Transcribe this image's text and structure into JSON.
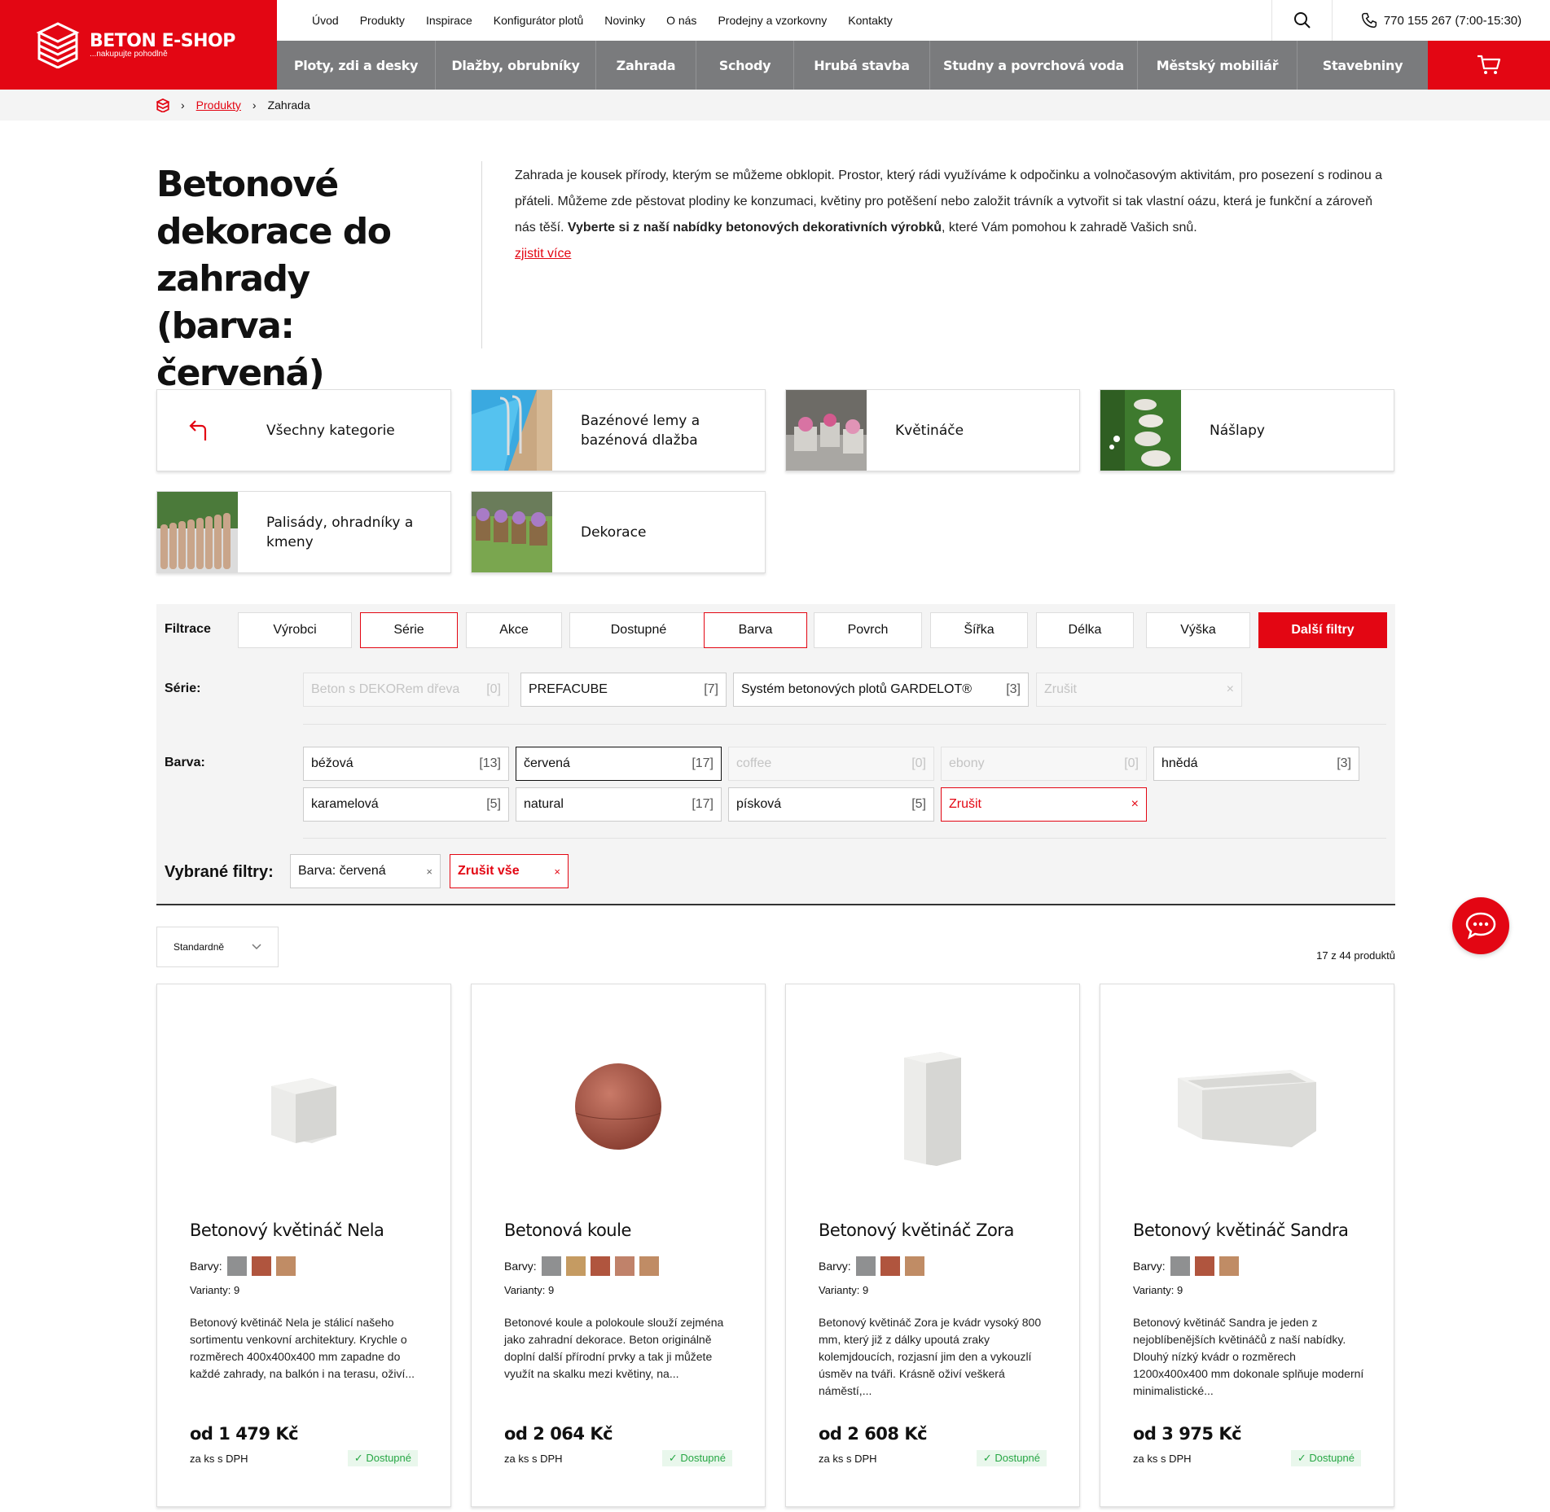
{
  "brand": {
    "name": "BETON E-SHOP",
    "tagline": "...nakupujte pohodlně"
  },
  "topnav": [
    "Úvod",
    "Produkty",
    "Inspirace",
    "Konfigurátor plotů",
    "Novinky",
    "O nás",
    "Prodejny a vzorkovny",
    "Kontakty"
  ],
  "phone": "770 155 267  (7:00-15:30)",
  "mainnav": [
    "Ploty, zdi a desky",
    "Dlažby, obrubníky",
    "Zahrada",
    "Schody",
    "Hrubá stavba",
    "Studny a povrchová voda",
    "Městský mobiliář",
    "Stavebniny"
  ],
  "breadcrumb": {
    "link": "Produkty",
    "current": "Zahrada"
  },
  "page": {
    "title": "Betonové dekorace do zahrady (barva: červená)",
    "intro_a": "Zahrada je kousek přírody, kterým se můžeme obklopit. Prostor, který rádi využíváme k odpočinku a volnočasovým aktivitám, pro posezení s rodinou a přáteli. Můžeme zde pěstovat plodiny ke konzumaci, květiny pro potěšení nebo založit trávník a vytvořit si tak vlastní oázu, která je funkční a zároveň nás těší. ",
    "intro_b": "Vyberte si z naší nabídky betonových dekorativních výrobků",
    "intro_c": ", které Vám pomohou k zahradě Vašich snů.",
    "more": "zjistit více"
  },
  "categories": [
    "Všechny kategorie",
    "Bazénové lemy a bazénová dlažba",
    "Květináče",
    "Nášlapy",
    "Palisády, ohradníky a kmeny",
    "Dekorace"
  ],
  "filters": {
    "label": "Filtrace",
    "tabs": [
      "Výrobci",
      "Série",
      "Akce",
      "Dostupné",
      "Barva",
      "Povrch",
      "Šířka",
      "Délka",
      "Výška",
      "Další filtry"
    ],
    "series_label": "Série:",
    "series": [
      {
        "name": "Beton s DEKORem dřeva",
        "count": "[0]"
      },
      {
        "name": "PREFACUBE",
        "count": "[7]"
      },
      {
        "name": "Systém betonových plotů GARDELOT®",
        "count": "[3]"
      },
      {
        "name": "Zrušit",
        "count": "×"
      }
    ],
    "color_label": "Barva:",
    "colors": [
      {
        "name": "béžová",
        "count": "[13]"
      },
      {
        "name": "červená",
        "count": "[17]"
      },
      {
        "name": "coffee",
        "count": "[0]"
      },
      {
        "name": "ebony",
        "count": "[0]"
      },
      {
        "name": "hnědá",
        "count": "[3]"
      },
      {
        "name": "karamelová",
        "count": "[5]"
      },
      {
        "name": "natural",
        "count": "[17]"
      },
      {
        "name": "písková",
        "count": "[5]"
      },
      {
        "name": "Zrušit",
        "count": "×"
      }
    ],
    "selected_label": "Vybrané filtry:",
    "selected": [
      {
        "name": "Barva: červená",
        "x": "×"
      },
      {
        "name": "Zrušit vše",
        "x": "×"
      }
    ]
  },
  "sort": "Standardně",
  "count": "17 z 44 produktů",
  "products": [
    {
      "name": "Betonový květináč Nela",
      "colors_label": "Barvy:",
      "variants": "Varianty: 9",
      "desc": "Betonový květináč Nela je stálicí našeho sortimentu venkovní architektury. Krychle o rozměrech 400x400x400 mm zapadne do každé zahrady, na balkón i na terasu, oživí...",
      "price": "od 1 479 Kč",
      "vat": "za ks s DPH",
      "avail": "✓ Dostupné",
      "swatches": [
        "#8f9091",
        "#b0553e",
        "#c08c65"
      ]
    },
    {
      "name": "Betonová koule",
      "colors_label": "Barvy:",
      "variants": "Varianty: 9",
      "desc": "Betonové koule a polokoule slouží zejména jako zahradní dekorace. Beton originálně doplní další přírodní prvky a tak ji můžete využít na skalku mezi květiny, na...",
      "price": "od 2 064 Kč",
      "vat": "za ks s DPH",
      "avail": "✓ Dostupné",
      "swatches": [
        "#8f9091",
        "#c59b62",
        "#b0553e",
        "#c0826a",
        "#c08c65"
      ]
    },
    {
      "name": "Betonový květináč Zora",
      "colors_label": "Barvy:",
      "variants": "Varianty: 9",
      "desc": "Betonový květináč Zora je kvádr vysoký 800 mm, který již z dálky upoutá zraky kolemjdoucích, rozjasní jim den a vykouzlí úsměv na tváři. Krásně oživí veškerá náměstí,...",
      "price": "od 2 608 Kč",
      "vat": "za ks s DPH",
      "avail": "✓ Dostupné",
      "swatches": [
        "#8f9091",
        "#b0553e",
        "#c08c65"
      ]
    },
    {
      "name": "Betonový květináč Sandra",
      "colors_label": "Barvy:",
      "variants": "Varianty: 9",
      "desc": "Betonový květináč Sandra je jeden z nejoblíbenějších květináčů z naší nabídky. Dlouhý nízký kvádr o rozměrech 1200x400x400 mm dokonale splňuje moderní minimalistické...",
      "price": "od 3 975 Kč",
      "vat": "za ks s DPH",
      "avail": "✓ Dostupné",
      "swatches": [
        "#8f9091",
        "#b0553e",
        "#c08c65"
      ]
    }
  ]
}
